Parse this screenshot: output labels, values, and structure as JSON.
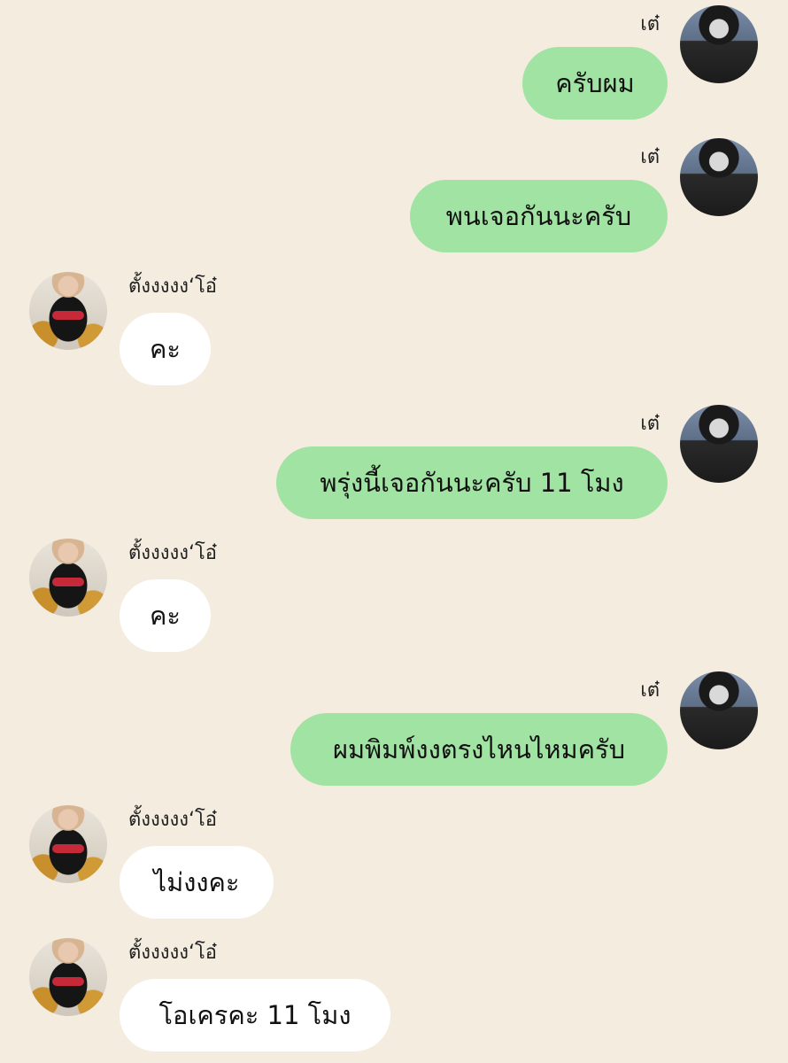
{
  "chat": {
    "messages": [
      {
        "side": "right",
        "sender": "เต๋",
        "text": "ครับผม"
      },
      {
        "side": "right",
        "sender": "เต๋",
        "text": "พนเจอกันนะครับ"
      },
      {
        "side": "left",
        "sender": "ตั้งงงงง‘โอ๋",
        "text": "คะ"
      },
      {
        "side": "right",
        "sender": "เต๋",
        "text": "พรุ่งนี้เจอกันนะครับ 11 โมง"
      },
      {
        "side": "left",
        "sender": "ตั้งงงงง‘โอ๋",
        "text": "คะ"
      },
      {
        "side": "right",
        "sender": "เต๋",
        "text": "ผมพิมพ์งงตรงไหนไหมครับ"
      },
      {
        "side": "left",
        "sender": "ตั้งงงงง‘โอ๋",
        "text": "ไม่งงคะ"
      },
      {
        "side": "left",
        "sender": "ตั้งงงงง‘โอ๋",
        "text": "โอเครคะ 11 โมง"
      }
    ]
  },
  "colors": {
    "background": "#f4ecdf",
    "outgoing_bubble": "#a1e3a2",
    "incoming_bubble": "#ffffff"
  }
}
